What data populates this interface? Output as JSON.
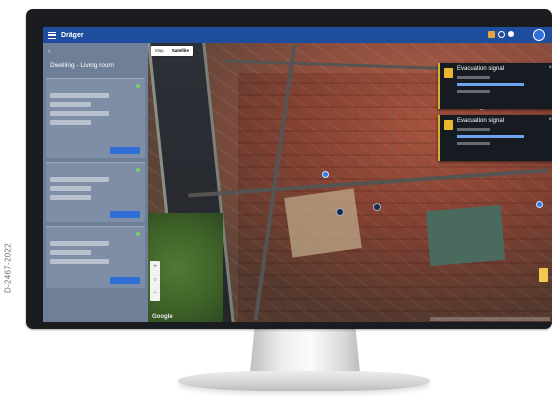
{
  "figure_code": "D-2467-2022",
  "app": {
    "logo": "Dräger",
    "title": ""
  },
  "sidebar": {
    "back_label": "",
    "title": "Dwelling - Living room",
    "cards": [
      {
        "header": "",
        "button": ""
      },
      {
        "header": "",
        "button": ""
      },
      {
        "header": "",
        "button": ""
      }
    ]
  },
  "map": {
    "view_options": [
      "Map",
      "Satellite"
    ],
    "active_view": "Satellite",
    "provider_mark": "Google"
  },
  "alerts": [
    {
      "title": "Evacuation signal",
      "icon": "alarm-icon"
    },
    {
      "title": "Evacuation signal",
      "icon": "alarm-icon"
    }
  ],
  "colors": {
    "appbar": "#1f4d9e",
    "sidebar": "#6f7f98",
    "alert_accent": "#e9b830",
    "button": "#2f6fd6",
    "status_ok": "#7bd36b"
  }
}
